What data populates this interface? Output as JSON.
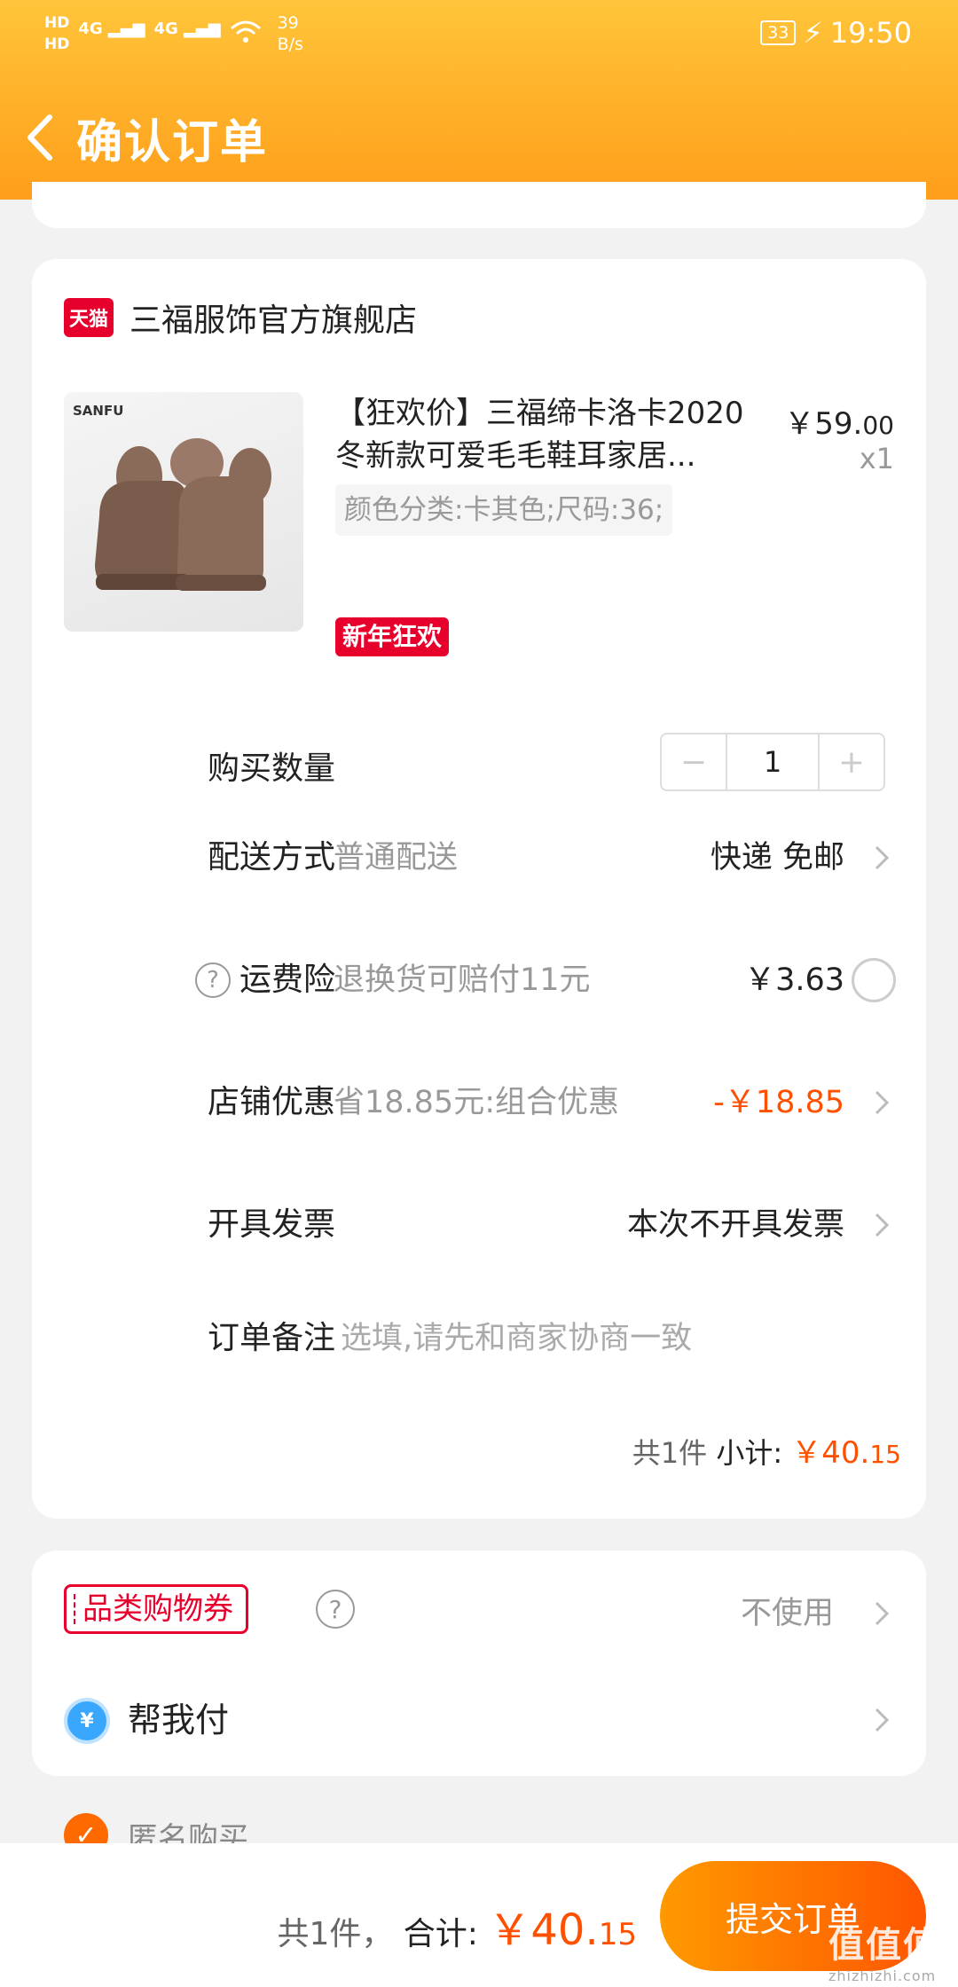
{
  "status_bar": {
    "hd1": "HD",
    "hd2": "HD",
    "signal1": "4G",
    "signal2": "4G",
    "speed_value": "39",
    "speed_unit": "B/s",
    "battery": "33",
    "time": "19:50"
  },
  "header": {
    "title": "确认订单",
    "back_icon": "chevron-left-icon"
  },
  "shop": {
    "platform_badge": "天猫",
    "name": "三福服饰官方旗舰店"
  },
  "product": {
    "image_brand": "SANFU",
    "title_line1": "【狂欢价】三福缔卡洛卡2020",
    "title_line2": "冬新款可爱毛毛鞋耳家居...",
    "price_main": "￥59.",
    "price_cents": "00",
    "quantity": "x1",
    "sku": "颜色分类:卡其色;尺码:36;",
    "promo_badge": "新年狂欢"
  },
  "rows": {
    "quantity": {
      "label": "购买数量",
      "minus": "−",
      "value": "1",
      "plus": "+"
    },
    "shipping": {
      "label": "配送方式",
      "desc": "普通配送",
      "value": "快递 免邮"
    },
    "insurance": {
      "label": "运费险",
      "help": "?",
      "desc": "退换货可赔付11元",
      "value": "￥3.63"
    },
    "discount": {
      "label": "店铺优惠",
      "desc": "省18.85元:组合优惠",
      "value": "-￥18.85"
    },
    "invoice": {
      "label": "开具发票",
      "value": "本次不开具发票"
    },
    "note": {
      "label": "订单备注",
      "placeholder": "选填,请先和商家协商一致"
    }
  },
  "subtotal": {
    "count": "共1件",
    "label": "小计:",
    "amount_main": "￥40.",
    "amount_cents": "15"
  },
  "coupon": {
    "tag": "品类购物券",
    "help": "?",
    "value": "不使用"
  },
  "pay_for_me": {
    "icon": "¥",
    "label": "帮我付"
  },
  "anonymous": {
    "label": "匿名购买",
    "checked": true
  },
  "bottom_bar": {
    "count": "共1件，",
    "label": "合计:",
    "amount_main": "￥40.",
    "amount_cents": "15",
    "submit": "提交订单"
  },
  "watermark": {
    "text": "值值值",
    "sub": "zhizhizhi.com"
  },
  "colors": {
    "accent": "#ff5000",
    "header_top": "#ffc53a",
    "header_bottom": "#ff9e1a",
    "tmall_red": "#e8002d"
  }
}
